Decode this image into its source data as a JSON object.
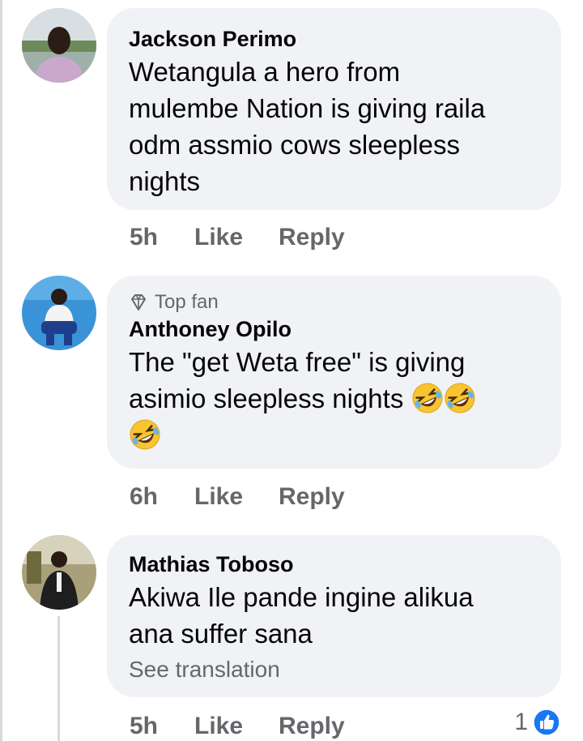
{
  "comments": [
    {
      "author": "Jackson Perimo",
      "text_lines": [
        "Wetangula a hero from",
        "mulembe Nation is giving raila",
        "odm assmio cows sleepless",
        "nights"
      ],
      "time": "5h",
      "like_label": "Like",
      "reply_label": "Reply"
    },
    {
      "badge": "Top fan",
      "author": "Anthoney Opilo",
      "text_lines": [
        "The \"get Weta free\" is giving",
        "asimio sleepless nights"
      ],
      "time": "6h",
      "like_label": "Like",
      "reply_label": "Reply"
    },
    {
      "author": "Mathias Toboso",
      "text_lines": [
        "Akiwa Ile pande ingine alikua",
        "ana suffer sana"
      ],
      "see_translation": "See translation",
      "time": "5h",
      "like_label": "Like",
      "reply_label": "Reply",
      "reaction_count": "1"
    }
  ],
  "icons": {
    "badge": "diamond-icon",
    "emoji": "rolling-laughing-emoji",
    "reaction": "thumbs-up-icon"
  },
  "colors": {
    "bubble": "#f0f2f5",
    "secondary_text": "#65676b",
    "like_blue": "#1877f2"
  }
}
